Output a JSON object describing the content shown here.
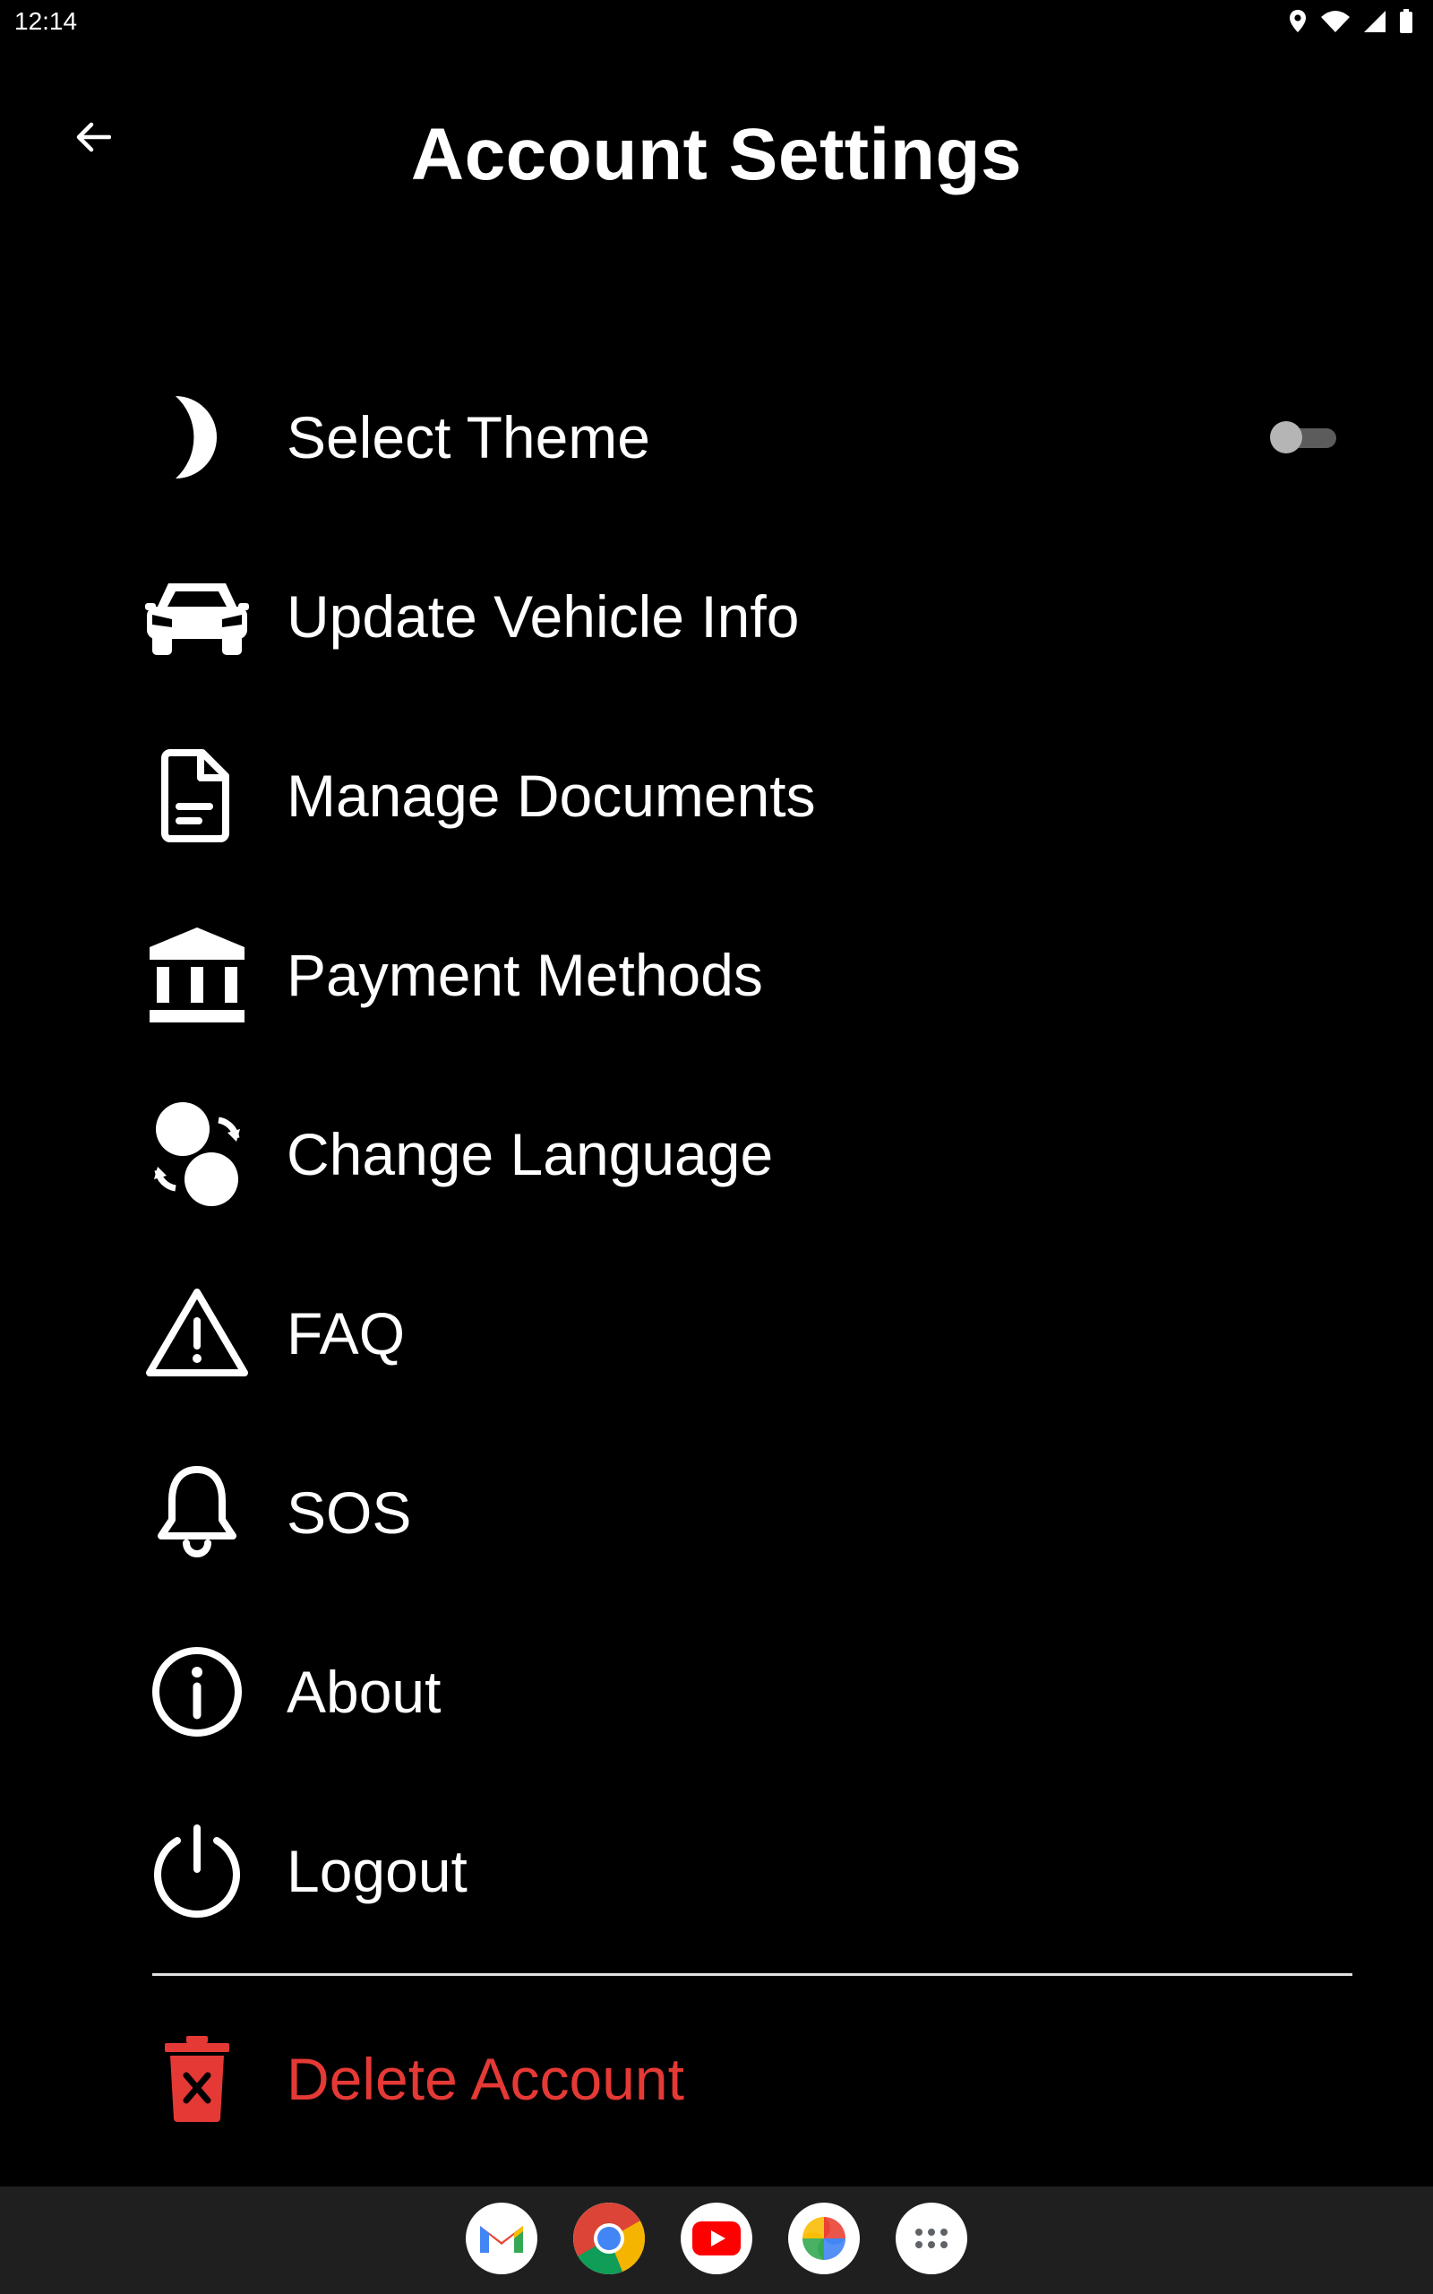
{
  "status_bar": {
    "time": "12:14",
    "icons": [
      "location-icon",
      "wifi-icon",
      "cell-signal-icon",
      "battery-icon"
    ]
  },
  "header": {
    "back_icon": "arrow-left-icon",
    "title": "Account Settings"
  },
  "menu": {
    "items": [
      {
        "label": "Select Theme",
        "icon": "moon-icon",
        "has_toggle": true,
        "toggle_on": false
      },
      {
        "label": "Update Vehicle Info",
        "icon": "car-icon"
      },
      {
        "label": "Manage Documents",
        "icon": "document-icon"
      },
      {
        "label": "Payment Methods",
        "icon": "bank-icon"
      },
      {
        "label": "Change Language",
        "icon": "language-switch-icon"
      },
      {
        "label": "FAQ",
        "icon": "warning-triangle-icon"
      },
      {
        "label": "SOS",
        "icon": "bell-icon"
      },
      {
        "label": "About",
        "icon": "info-icon"
      },
      {
        "label": "Logout",
        "icon": "power-icon"
      }
    ],
    "danger_item": {
      "label": "Delete Account",
      "icon": "trash-icon",
      "color": "#e53935"
    }
  },
  "taskbar": {
    "apps": [
      "Gmail",
      "Chrome",
      "YouTube",
      "Photos",
      "App drawer"
    ]
  },
  "colors": {
    "background": "#000000",
    "text": "#ffffff",
    "danger": "#e53935",
    "taskbar": "#1f1f1f"
  }
}
